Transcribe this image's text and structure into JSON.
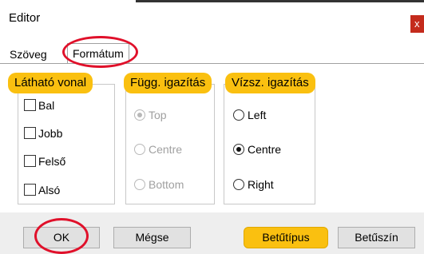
{
  "window": {
    "title": "Editor",
    "close_label": "x"
  },
  "tabs": [
    {
      "label": "Szöveg"
    },
    {
      "label": "Formátum"
    }
  ],
  "groups": {
    "visible_line": {
      "title": "Látható vonal",
      "items": [
        {
          "label": "Bal",
          "checked": false
        },
        {
          "label": "Jobb",
          "checked": false
        },
        {
          "label": "Felső",
          "checked": false
        },
        {
          "label": "Alsó",
          "checked": false
        }
      ]
    },
    "vertical_align": {
      "title": "Függ. igazítás",
      "disabled": true,
      "options": [
        {
          "label": "Top",
          "checked": true
        },
        {
          "label": "Centre",
          "checked": false
        },
        {
          "label": "Bottom",
          "checked": false
        }
      ]
    },
    "horizontal_align": {
      "title": "Vízsz. igazítás",
      "options": [
        {
          "label": "Left",
          "checked": false
        },
        {
          "label": "Centre",
          "checked": true
        },
        {
          "label": "Right",
          "checked": false
        }
      ]
    }
  },
  "buttons": {
    "ok": "OK",
    "cancel": "Mégse",
    "font": "Betűtípus",
    "font_color": "Betűszín"
  },
  "colors": {
    "highlight": "#fac010",
    "annotation_circle": "#e0102a",
    "close_button": "#c42b1c"
  }
}
